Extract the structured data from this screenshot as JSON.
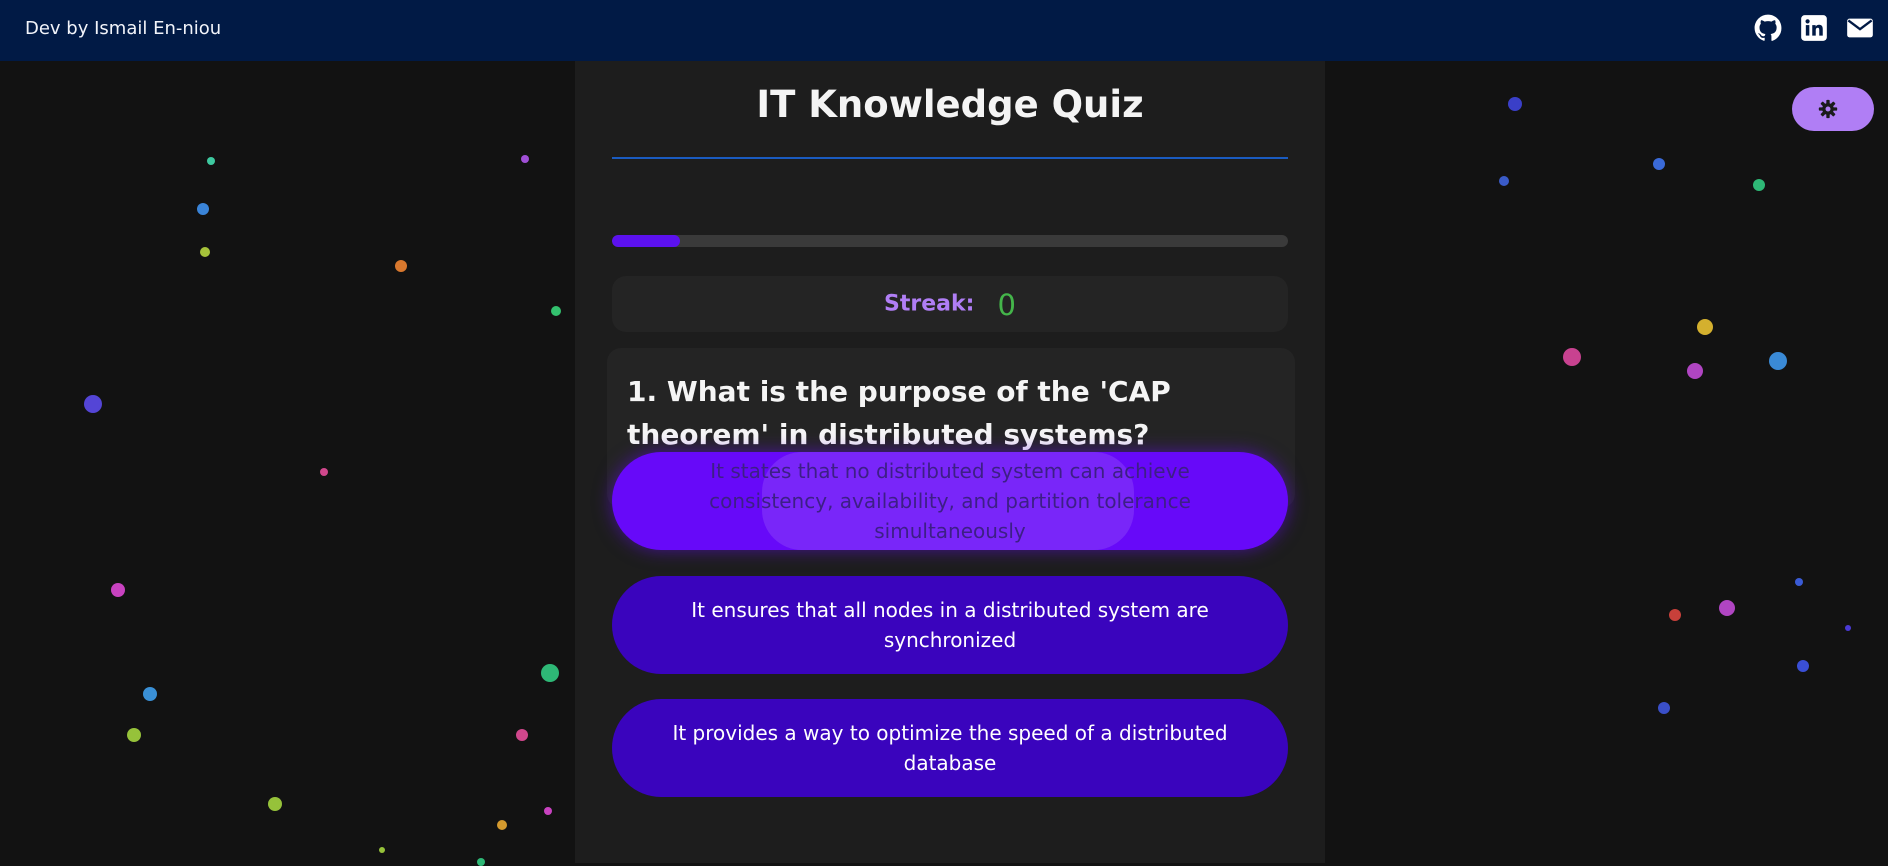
{
  "header": {
    "brand": "Dev by Ismail En-niou",
    "icons": [
      "github-icon",
      "linkedin-icon",
      "mail-icon"
    ]
  },
  "theme_toggle": {
    "icon": "gear-icon"
  },
  "quiz": {
    "title": "IT Knowledge Quiz",
    "progress_fraction": 0.1,
    "streak_label": "Streak:",
    "streak_value": "0",
    "question": "1. What is the purpose of the 'CAP theorem' in distributed systems?",
    "options": [
      "It states that no distributed system can achieve consistency, availability, and partition tolerance simultaneously",
      "It ensures that all nodes in a distributed system are synchronized",
      "It provides a way to optimize the speed of a distributed database"
    ],
    "selected_option": 0
  },
  "colors": {
    "background": "#121212",
    "header": "#011a45",
    "card": "#1d1d1d",
    "accent": "#6709f9",
    "option": "#3a04bd",
    "streak_label": "#b07ef5",
    "streak_value": "#44b54a",
    "title_rule": "#1a5bc0"
  }
}
